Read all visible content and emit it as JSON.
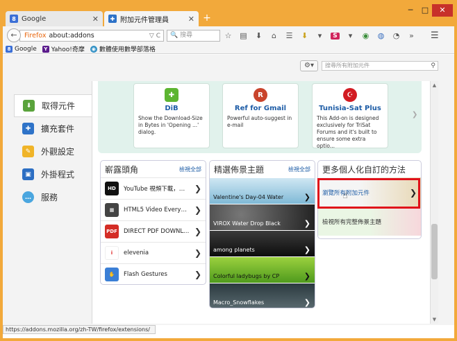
{
  "tabs": [
    {
      "label": "Google",
      "active": false,
      "icon": "google-icon"
    },
    {
      "label": "附加元件管理員",
      "active": true,
      "icon": "puzzle-icon"
    }
  ],
  "toolbar": {
    "url_prefix": "Firefox",
    "url": "about:addons",
    "search_placeholder": "搜尋"
  },
  "bookmarks": [
    {
      "label": "Google",
      "icon": "google-icon"
    },
    {
      "label": "Yahoo!奇摩",
      "icon": "yahoo-icon"
    },
    {
      "label": "數體使用數學部落格",
      "icon": "globe-icon"
    }
  ],
  "addons_search_placeholder": "搜尋所有附加元件",
  "sidebar": {
    "items": [
      {
        "label": "取得元件",
        "selected": true,
        "icon": "download-icon"
      },
      {
        "label": "擴充套件",
        "selected": false,
        "icon": "puzzle-icon"
      },
      {
        "label": "外觀設定",
        "selected": false,
        "icon": "paintbrush-icon"
      },
      {
        "label": "外掛程式",
        "selected": false,
        "icon": "plugin-icon"
      },
      {
        "label": "服務",
        "selected": false,
        "icon": "chat-icon"
      }
    ]
  },
  "featured": [
    {
      "title": "DiB",
      "desc": "Show the Download-Size in Bytes in 'Opening ...' dialog.",
      "icon_color": "#5cb531"
    },
    {
      "title": "Ref for Gmail",
      "desc": "Powerful auto-suggest in e-mail",
      "icon_color": "#c9442c"
    },
    {
      "title": "Tunisia-Sat Plus",
      "desc": "This Add-on is designed exclusively for TriSat Forums and it's built to ensure some extra optio...",
      "icon_color": "#d21b22"
    }
  ],
  "panels": {
    "left": {
      "title": "嶄露頭角",
      "see_all": "檢視全部",
      "items": [
        {
          "label": "YouTube 視頻下載，自...",
          "icon": "hd-icon"
        },
        {
          "label": "HTML5 Video Everywh...",
          "icon": "film-icon"
        },
        {
          "label": "DIRECT PDF DOWNLO...",
          "icon": "pdf-icon"
        },
        {
          "label": "elevenia",
          "icon": "elevenia-icon"
        },
        {
          "label": "Flash Gestures",
          "icon": "gesture-icon"
        }
      ]
    },
    "middle": {
      "title": "精選佈景主題",
      "see_all": "檢視全部",
      "items": [
        {
          "label": "Valentine's Day-04 Water"
        },
        {
          "label": "VIROX Water Drop Black"
        },
        {
          "label": "among planets"
        },
        {
          "label": "Colorful ladybugs by CP"
        },
        {
          "label": "Macro_Snowflakes"
        }
      ]
    },
    "right": {
      "title": "更多個人化自訂的方法",
      "items": [
        {
          "label": "瀏覽所有附加元件"
        },
        {
          "label": "檢視所有完整佈景主題"
        }
      ]
    }
  },
  "status_url": "https://addons.mozilla.org/zh-TW/firefox/extensions/"
}
